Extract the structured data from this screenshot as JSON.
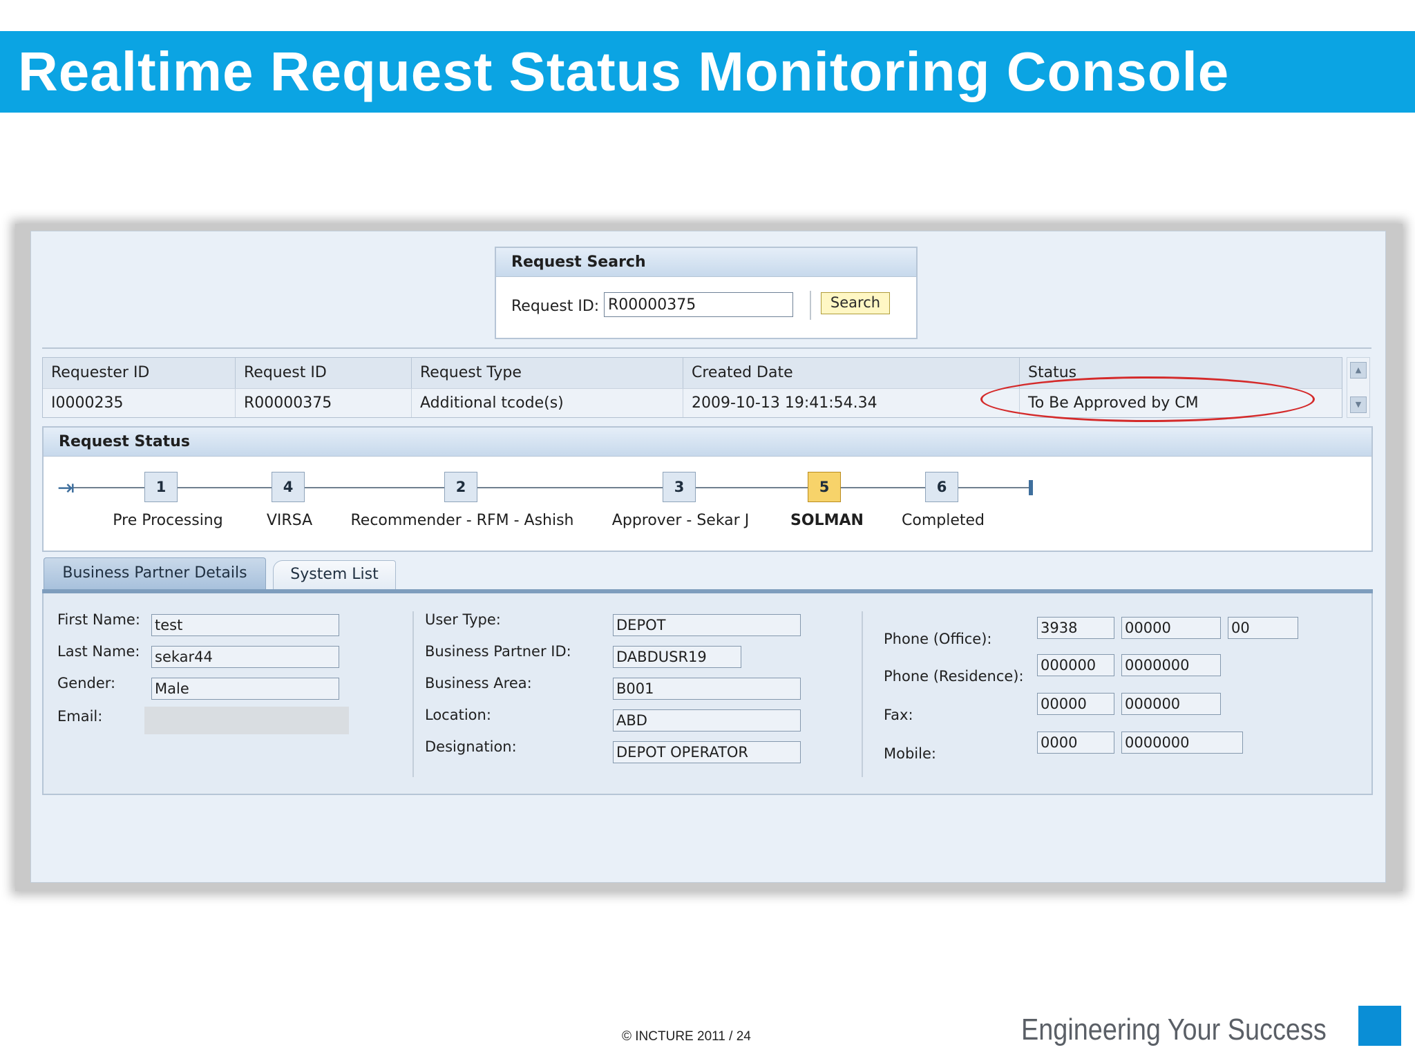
{
  "slide": {
    "title": "Realtime Request Status Monitoring Console",
    "footer_copyright": "©  INCTURE 2011 / 24",
    "tagline": "Engineering Your Success"
  },
  "search": {
    "header": "Request Search",
    "label": "Request ID:",
    "value": "R00000375",
    "button": "Search"
  },
  "table": {
    "columns": [
      "Requester ID",
      "Request ID",
      "Request Type",
      "Created Date",
      "Status"
    ],
    "rows": [
      [
        "I0000235",
        "R00000375",
        "Additional tcode(s)",
        "2009-10-13 19:41:54.34",
        "To Be Approved by CM"
      ]
    ]
  },
  "request_status": {
    "header": "Request Status",
    "steps": [
      {
        "number": "1",
        "label": "Pre Processing",
        "active": false
      },
      {
        "number": "4",
        "label": "VIRSA",
        "active": false
      },
      {
        "number": "2",
        "label": "Recommender - RFM - Ashish",
        "active": false
      },
      {
        "number": "3",
        "label": "Approver - Sekar J",
        "active": false
      },
      {
        "number": "5",
        "label": "SOLMAN",
        "active": true
      },
      {
        "number": "6",
        "label": "Completed",
        "active": false
      }
    ]
  },
  "tabs": [
    "Business Partner Details",
    "System List"
  ],
  "details": {
    "personal": [
      {
        "label": "First Name:",
        "value": "test"
      },
      {
        "label": "Last Name:",
        "value": "sekar44"
      },
      {
        "label": "Gender:",
        "value": "Male"
      },
      {
        "label": "Email:",
        "value": ""
      }
    ],
    "business": [
      {
        "label": "User Type:",
        "value": "DEPOT"
      },
      {
        "label": "Business Partner ID:",
        "value": "DABDUSR19"
      },
      {
        "label": "Business Area:",
        "value": "B001"
      },
      {
        "label": "Location:",
        "value": "ABD"
      },
      {
        "label": "Designation:",
        "value": "DEPOT OPERATOR"
      }
    ],
    "contact": [
      {
        "label": "Phone (Office):",
        "values": [
          "3938",
          "00000",
          "00"
        ]
      },
      {
        "label": "Phone (Residence):",
        "values": [
          "000000",
          "0000000"
        ]
      },
      {
        "label": "Fax:",
        "values": [
          "00000",
          "000000"
        ]
      },
      {
        "label": "Mobile:",
        "values": [
          "0000",
          "0000000"
        ]
      }
    ]
  },
  "colors": {
    "banner": "#0ba4e3",
    "active_step": "#f7d36a",
    "highlight": "#d42a2a",
    "corner_square": "#0a8ed6"
  }
}
